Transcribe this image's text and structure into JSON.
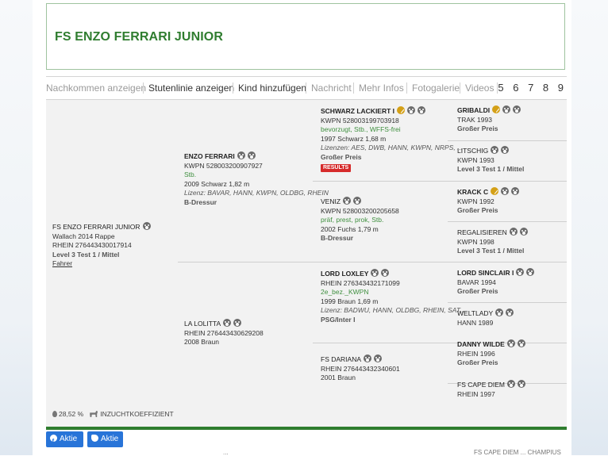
{
  "title": "FS ENZO FERRARI JUNIOR",
  "nav": {
    "items": [
      {
        "label": "Nachkommen anzeigen"
      },
      {
        "label": "Stutenlinie anzeigen"
      },
      {
        "label": "Kind hinzufügen"
      },
      {
        "label": "Nachricht"
      },
      {
        "label": "Mehr Infos"
      },
      {
        "label": "Fotogalerie"
      },
      {
        "label": "Videos"
      }
    ],
    "pages": "5 6 7 8 9"
  },
  "pedigree": {
    "subject": {
      "name": "FS ENZO FERRARI JUNIOR",
      "line1": "Wallach 2014 Rappe",
      "line2": "RHEIN 276443430017914",
      "line3": "Level 3 Test 1 / Mittel",
      "link": "Fahrer"
    },
    "sire": {
      "name": "ENZO FERRARI",
      "line1": "KWPN 528003200907927",
      "line2": "Stb.",
      "line3": "2009 Schwarz 1,82 m",
      "line4": "Lizenz: BAVAR, HANN, KWPN, OLDBG, RHEIN",
      "line5": "B-Dressur"
    },
    "dam": {
      "name": "LA LOLITTA",
      "line1": "RHEIN 276443430629208",
      "line2": "2008 Braun"
    },
    "ss": {
      "name": "SCHWARZ LACKIERT I",
      "line1": "KWPN 528003199703918",
      "line2": "bevorzugt, Stb., WFFS-frei",
      "line3": "1997 Schwarz 1,68 m",
      "line4": "Lizenzen: AES, DWB, HANN, KWPN, NRPS, ...",
      "line5": "Großer Preis",
      "badge": "RESULTS"
    },
    "sd": {
      "name": "VENIZ",
      "line1": "KWPN 528003200205658",
      "line2": "präf, prest, prok, Stb.",
      "line3": "2002 Fuchs 1,79 m",
      "line4": "B-Dressur"
    },
    "ds": {
      "name": "LORD LOXLEY",
      "line1": "RHEIN 276343432171099",
      "line2": "2e_bez._KWPN",
      "line3": "1999 Braun 1,69 m",
      "line4": "Lizenz: BADWU, HANN, OLDBG, RHEIN, SAT...",
      "line5": "PSG/Inter I"
    },
    "dd": {
      "name": "FS DARIANA",
      "line1": "RHEIN 276443432340601",
      "line2": "2001 Braun"
    },
    "g1": {
      "name": "GRIBALDI",
      "line1": "TRAK 1993",
      "line2": "Großer Preis"
    },
    "g2": {
      "name": "LITSCHIG",
      "line1": "KWPN 1993",
      "line2": "Level 3 Test 1 / Mittel"
    },
    "g3": {
      "name": "KRACK C",
      "line1": "KWPN 1992",
      "line2": "Großer Preis"
    },
    "g4": {
      "name": "REGALISIEREN",
      "line1": "KWPN 1998",
      "line2": "Level 3 Test 1 / Mittel"
    },
    "g5": {
      "name": "LORD SINCLAIR I",
      "line1": "BAVAR 1994",
      "line2": "Großer Preis"
    },
    "g6": {
      "name": "WELTLADY",
      "line1": "HANN 1989"
    },
    "g7": {
      "name": "DANNY WILDE",
      "line1": "RHEIN 1996",
      "line2": "Großer Preis"
    },
    "g8": {
      "name": "FS CAPE DIEM",
      "line1": "RHEIN 1997"
    }
  },
  "stats": {
    "percent": "28,52 %",
    "label": "INZUCHTKOEFFIZIENT"
  },
  "share": {
    "facebook": "Aktie",
    "twitter": "Aktie"
  },
  "footer": {
    "left": "...",
    "right": "FS CAPE DIEM ... CHAMPIUS"
  }
}
